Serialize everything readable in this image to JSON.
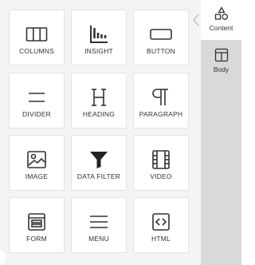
{
  "tiles": [
    {
      "label": "COLUMNS",
      "icon": "columns-icon"
    },
    {
      "label": "INSIGHT",
      "icon": "insight-chart-icon"
    },
    {
      "label": "BUTTON",
      "icon": "button-icon"
    },
    {
      "label": "DIVIDER",
      "icon": "divider-icon"
    },
    {
      "label": "HEADING",
      "icon": "heading-icon"
    },
    {
      "label": "PARAGRAPH",
      "icon": "paragraph-icon"
    },
    {
      "label": "IMAGE",
      "icon": "image-icon"
    },
    {
      "label": "DATA FILTER",
      "icon": "filter-icon"
    },
    {
      "label": "VIDEO",
      "icon": "video-icon"
    },
    {
      "label": "FORM",
      "icon": "form-icon"
    },
    {
      "label": "MENU",
      "icon": "menu-icon"
    },
    {
      "label": "HTML",
      "icon": "html-code-icon"
    }
  ],
  "sidebar": {
    "tabs": [
      {
        "label": "Content",
        "icon": "shapes-icon",
        "active": true
      },
      {
        "label": "Body",
        "icon": "layout-icon",
        "active": false
      }
    ]
  },
  "colors": {
    "panel_bg": "#f4f4f4",
    "tile_bg": "#ffffff",
    "sidebar_bg": "#d9d9d9",
    "icon": "#333333"
  }
}
